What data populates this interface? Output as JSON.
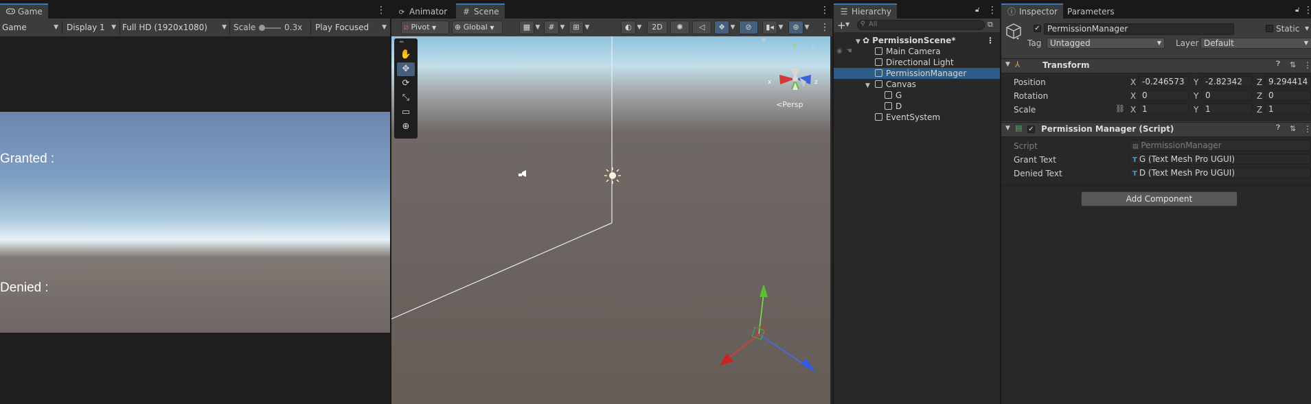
{
  "game_panel": {
    "tab_label": "Game",
    "toolbar": {
      "mode": "Game",
      "display": "Display 1",
      "resolution": "Full HD (1920x1080)",
      "scale_label": "Scale",
      "scale_value": "0.3x",
      "play_mode": "Play Focused"
    },
    "texts": {
      "granted": "Granted :",
      "denied": "Denied :"
    }
  },
  "scene_panel": {
    "tabs": [
      {
        "label": "Animator",
        "icon": "animator-icon"
      },
      {
        "label": "Scene",
        "icon": "grid-icon"
      }
    ],
    "toolbar": {
      "pivot": "Pivot",
      "global": "Global",
      "mode_2d": "2D"
    },
    "persp_label": "Persp",
    "gizmo_axes": {
      "x": "x",
      "y": "y",
      "z": "z"
    }
  },
  "hierarchy": {
    "tab_label": "Hierarchy",
    "search_placeholder": "All",
    "items": [
      {
        "label": "PermissionScene*"
      },
      {
        "label": "Main Camera"
      },
      {
        "label": "Directional Light"
      },
      {
        "label": "PermissionManager",
        "selected": true
      },
      {
        "label": "Canvas"
      },
      {
        "label": "G"
      },
      {
        "label": "D"
      },
      {
        "label": "EventSystem"
      }
    ]
  },
  "inspector": {
    "tabs": [
      {
        "label": "Inspector"
      },
      {
        "label": "Parameters"
      }
    ],
    "object_name": "PermissionManager",
    "static_label": "Static",
    "tag_label": "Tag",
    "tag_value": "Untagged",
    "layer_label": "Layer",
    "layer_value": "Default",
    "transform": {
      "title": "Transform",
      "position_label": "Position",
      "rotation_label": "Rotation",
      "scale_label": "Scale",
      "axis_labels": {
        "x": "X",
        "y": "Y",
        "z": "Z"
      },
      "position": {
        "x": "-0.246573",
        "y": "-2.82342",
        "z": "9.294414"
      },
      "rotation": {
        "x": "0",
        "y": "0",
        "z": "0"
      },
      "scale": {
        "x": "1",
        "y": "1",
        "z": "1"
      }
    },
    "script_component": {
      "title": "Permission Manager (Script)",
      "script_label": "Script",
      "script_value": "PermissionManager",
      "grant_label": "Grant Text",
      "grant_value": "G (Text Mesh Pro UGUI)",
      "denied_label": "Denied Text",
      "denied_value": "D (Text Mesh Pro UGUI)"
    },
    "add_component": "Add Component"
  },
  "colors": {
    "accent_blue": "#3a79bb",
    "selection": "#2c5d87",
    "panel_bg": "#282828",
    "toolbar_bg": "#3c3c3c"
  }
}
